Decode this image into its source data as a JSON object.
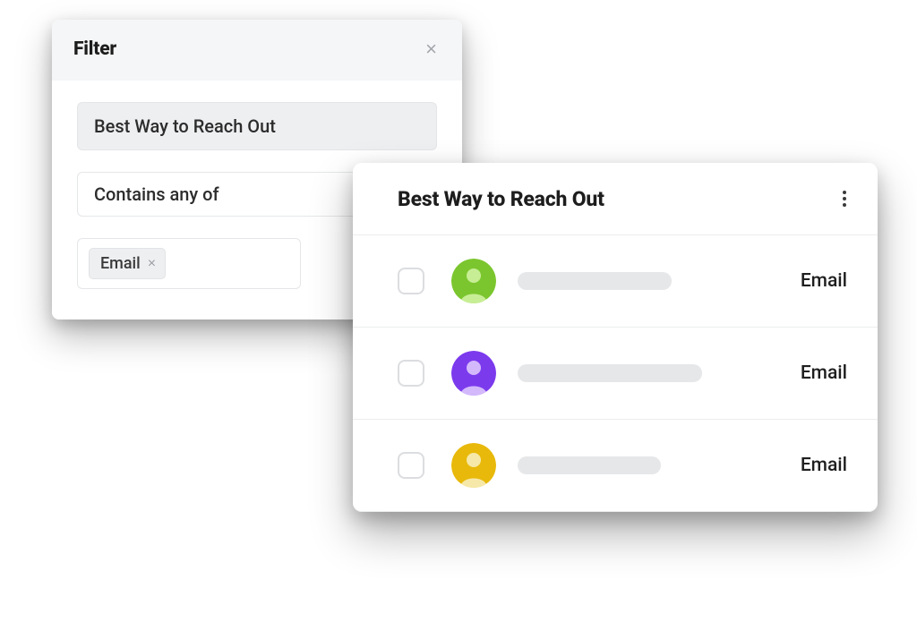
{
  "filter": {
    "title": "Filter",
    "field": "Best Way to Reach Out",
    "operator": "Contains any of",
    "tag": "Email"
  },
  "list": {
    "title": "Best Way to Reach Out",
    "rows": [
      {
        "avatar_bg": "#7bc62e",
        "avatar_body": "#c7ee95",
        "skel_width": 172,
        "value": "Email"
      },
      {
        "avatar_bg": "#7c3aed",
        "avatar_body": "#d3b9fb",
        "skel_width": 206,
        "value": "Email"
      },
      {
        "avatar_bg": "#e8b90b",
        "avatar_body": "#f6e8a9",
        "skel_width": 160,
        "value": "Email"
      }
    ]
  }
}
